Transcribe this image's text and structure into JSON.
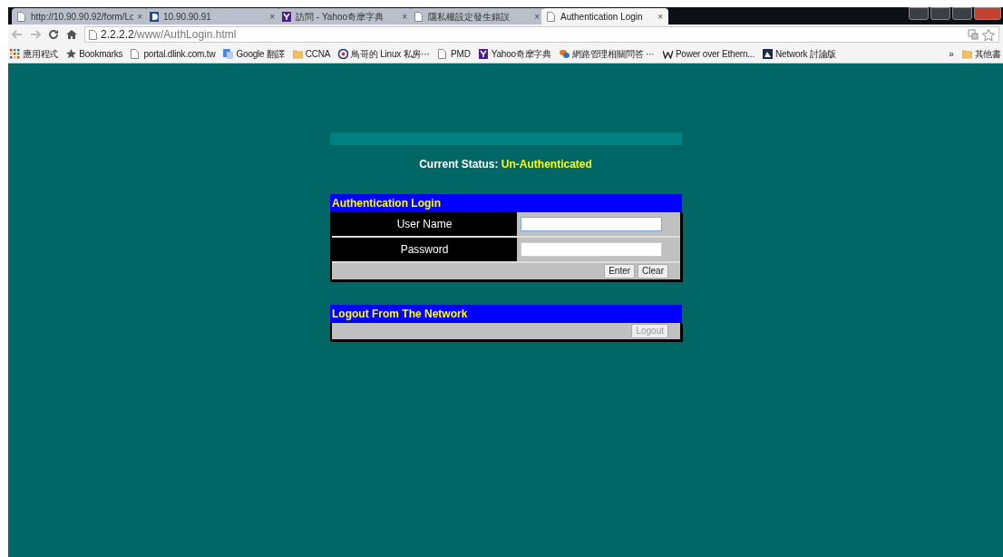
{
  "tabs": [
    {
      "title": "http://10.90.90.92/form/Lo",
      "close": "×",
      "selected": false
    },
    {
      "title": "10.90.90.91",
      "close": "×",
      "selected": false
    },
    {
      "title": "訪問 - Yahoo奇摩字典",
      "close": "×",
      "selected": false
    },
    {
      "title": "隱私權設定發生錯誤",
      "close": "×",
      "selected": false
    },
    {
      "title": "Authentication Login",
      "close": "×",
      "selected": true
    }
  ],
  "address": {
    "host": "2.2.2.2",
    "path": "/www/AuthLogin.html"
  },
  "bookmarks": [
    {
      "label": "應用程式"
    },
    {
      "label": "Bookmarks"
    },
    {
      "label": "portal.dlink.com.tw"
    },
    {
      "label": "Google 翻譯"
    },
    {
      "label": "CCNA"
    },
    {
      "label": "鳥哥的 Linux 私房⋯"
    },
    {
      "label": "PMD"
    },
    {
      "label": "Yahoo奇摩字典"
    },
    {
      "label": "網路管理相關問答 ⋯"
    },
    {
      "label": "Power over Ethern..."
    },
    {
      "label": "Network 討論版"
    }
  ],
  "bookmarks_more": "»",
  "other_bookmarks": "其他書",
  "status": {
    "label": "Current Status:",
    "value": "Un-Authenticated"
  },
  "login": {
    "title": "Authentication Login",
    "fields": [
      {
        "label": "User Name",
        "focused": true
      },
      {
        "label": "Password",
        "focused": false
      }
    ],
    "buttons": [
      {
        "label": "Enter",
        "disabled": false
      },
      {
        "label": "Clear",
        "disabled": false
      }
    ]
  },
  "logout": {
    "title": "Logout From The Network",
    "buttons": [
      {
        "label": "Logout",
        "disabled": true
      }
    ]
  }
}
